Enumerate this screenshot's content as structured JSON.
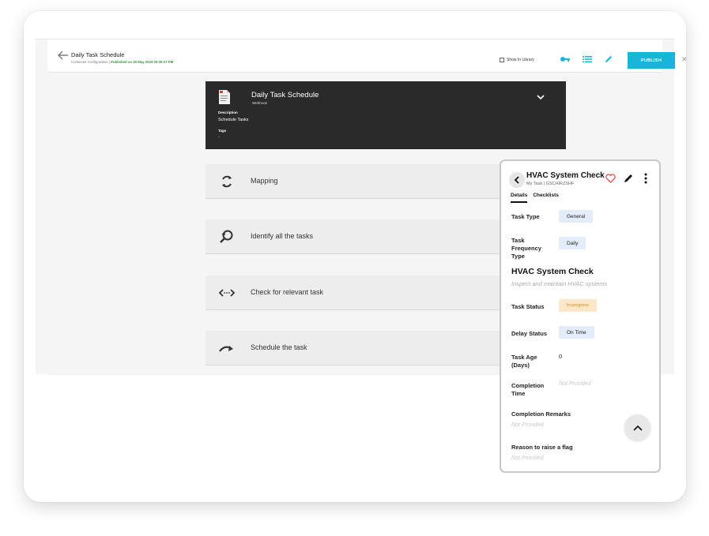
{
  "topbar": {
    "title": "Daily Task Schedule",
    "subtitle_prefix": "Connector Configuration | ",
    "published": "Published on 30 May 2024 04:39:27 PM",
    "show_in_library": "Show In Library",
    "publish_label": "PUBLISH",
    "close_label": "✕",
    "icons": [
      "back-arrow-icon",
      "key-icon",
      "list-icon",
      "pencil-icon"
    ]
  },
  "header_card": {
    "title": "Daily Task Schedule",
    "type": "Webhook",
    "description_label": "Description",
    "description": "Schedule Tasks",
    "tags_label": "Tags",
    "tags_value": "-"
  },
  "steps": [
    {
      "label": "Mapping",
      "icon": "sync-icon"
    },
    {
      "label": "Identify all the tasks",
      "icon": "search-refresh-icon"
    },
    {
      "label": "Check for relevant task",
      "icon": "code-arrows-icon"
    },
    {
      "label": "Schedule the task",
      "icon": "curved-arrow-icon"
    }
  ],
  "panel": {
    "title": "HVAC System Check",
    "subtitle": "My Task | GSCHIRZSHF",
    "tabs": [
      "Details",
      "Checklists"
    ],
    "task_type_label": "Task Type",
    "task_type": "General",
    "frequency_label": "Task Frequency Type",
    "frequency": "Daily",
    "heading": "HVAC System Check",
    "description": "Inspect and maintain HVAC systems",
    "status_label": "Task Status",
    "status": "In-progress",
    "delay_label": "Delay Status",
    "delay": "On Time",
    "age_label": "Task Age (Days)",
    "age": "0",
    "completion_time_label": "Completion Time",
    "completion_time": "Not Provided",
    "remarks_label": "Completion Remarks",
    "remarks": "Not Provided",
    "flag_label": "Reason to raise a flag",
    "flag": "Not Provided",
    "colors": {
      "accent": "#17b5d9",
      "heart": "#e03c3c",
      "status_bg": "#fde7c9",
      "status_fg": "#d98a18",
      "pill_blue": "#e3ecfb"
    }
  }
}
